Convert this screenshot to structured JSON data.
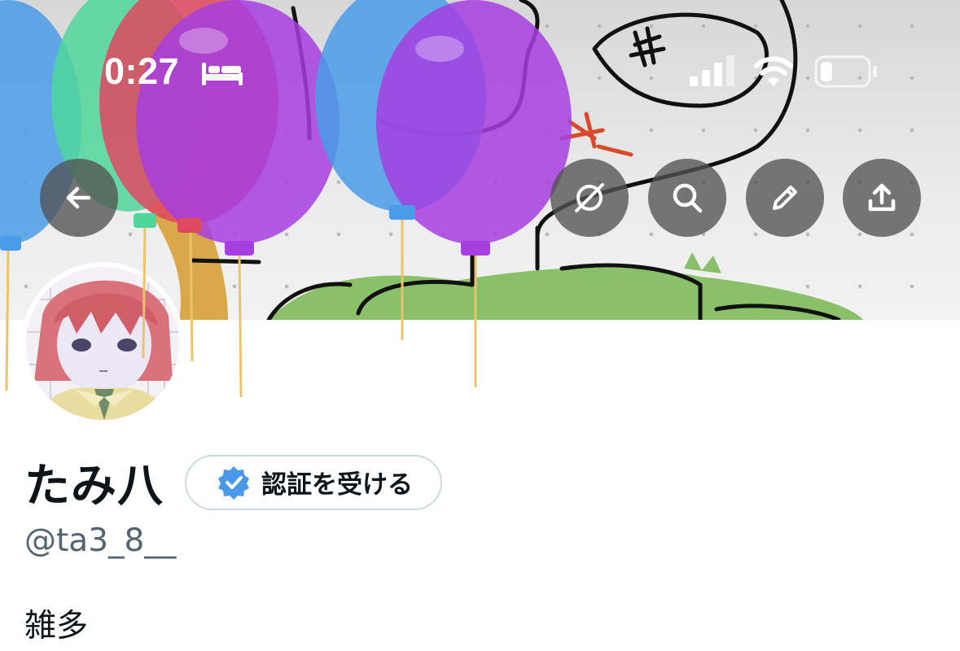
{
  "status_bar": {
    "time": "0:27",
    "focus_icon": "bed-icon",
    "signal_icon": "cellular-signal-icon",
    "wifi_icon": "wifi-icon",
    "battery_icon": "battery-low-icon"
  },
  "header_actions": {
    "back_icon": "arrow-left-icon",
    "circle_icon": "circle-slash-icon",
    "search_icon": "search-icon",
    "edit_icon": "pencil-icon",
    "share_icon": "share-icon"
  },
  "profile": {
    "display_name": "たみ八",
    "verify_label": "認証を受ける",
    "handle": "@ta3_8__",
    "bio": "雑多"
  },
  "colors": {
    "verify_badge": "#4a99e9",
    "button_overlay": "#525252",
    "handle_text": "#536471"
  }
}
